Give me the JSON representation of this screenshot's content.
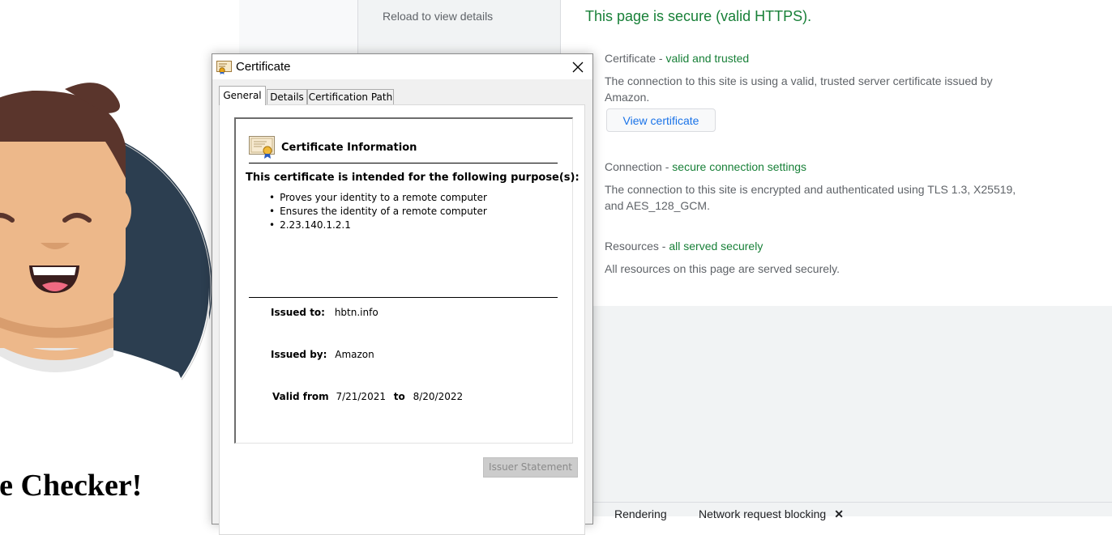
{
  "page": {
    "heading": "he Checker!"
  },
  "devtools": {
    "reload_text": "Reload to view details",
    "secure_title": "This page is secure (valid HTTPS).",
    "certificate": {
      "label": "Certificate",
      "separator": " - ",
      "status": "valid and trusted",
      "description": "The connection to this site is using a valid, trusted server certificate issued by Amazon.",
      "button_label": "View certificate"
    },
    "connection": {
      "label": "Connection",
      "separator": " - ",
      "status": "secure connection settings",
      "description": "The connection to this site is encrypted and authenticated using TLS 1.3, X25519, and AES_128_GCM."
    },
    "resources": {
      "label": "Resources",
      "separator": " - ",
      "status": "all served securely",
      "description": "All resources on this page are served securely."
    },
    "drawer_tabs": [
      "Rendering",
      "Network request blocking"
    ],
    "close_glyph": "✕",
    "colors": {
      "secure_green": "#188038",
      "link_blue": "#1a73e8",
      "muted_text": "#5f6368"
    }
  },
  "dialog": {
    "title": "Certificate",
    "tabs": [
      "General",
      "Details",
      "Certification Path"
    ],
    "active_tab": "General",
    "info_heading": "Certificate Information",
    "purpose_title": "This certificate is intended for the following purpose(s):",
    "purposes": [
      "Proves your identity to a remote computer",
      "Ensures the identity of a remote computer",
      "2.23.140.1.2.1"
    ],
    "issued_to_label": "Issued to:",
    "issued_to_value": "hbtn.info",
    "issued_by_label": "Issued by:",
    "issued_by_value": "Amazon",
    "valid_from_label": "Valid from",
    "valid_from_value": "7/21/2021",
    "valid_to_label": "to",
    "valid_to_value": "8/20/2022",
    "issuer_statement_label": "Issuer Statement"
  }
}
